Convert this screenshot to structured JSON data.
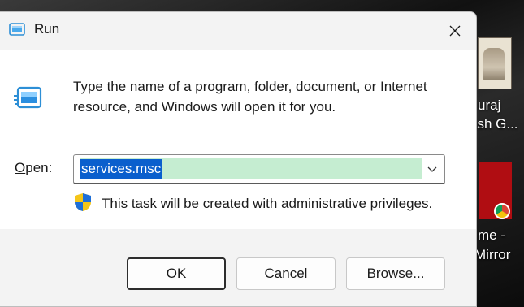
{
  "window": {
    "title": "Run",
    "icon": "run-icon"
  },
  "content": {
    "description": "Type the name of a program, folder, document, or Internet resource, and Windows will open it for you.",
    "open_label_accel": "O",
    "open_label_rest": "pen:",
    "open_value": "services.msc",
    "admin_note": "This task will be created with administrative privileges."
  },
  "buttons": {
    "ok": "OK",
    "cancel": "Cancel",
    "browse_accel": "B",
    "browse_rest": "rowse..."
  },
  "desktop": {
    "items": [
      {
        "line1": "uraj",
        "line2": "ash G..."
      },
      {
        "line1": "me -",
        "line2": "Mirror"
      }
    ]
  },
  "colors": {
    "selection": "#0a5fcd",
    "highlight": "#c5edd1",
    "dialog_bg": "#f3f3f3"
  }
}
